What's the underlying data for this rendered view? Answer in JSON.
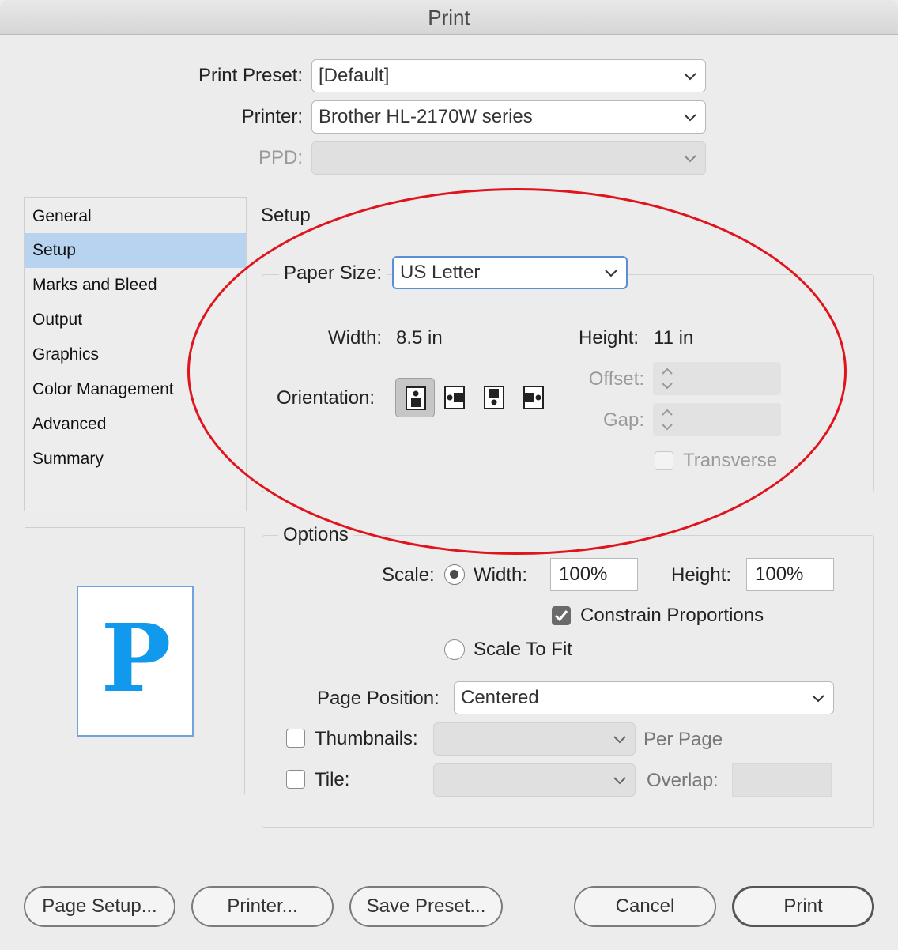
{
  "window": {
    "title": "Print"
  },
  "top": {
    "preset_label": "Print Preset:",
    "preset_value": "[Default]",
    "printer_label": "Printer:",
    "printer_value": "Brother HL-2170W series",
    "ppd_label": "PPD:",
    "ppd_value": ""
  },
  "sidebar": {
    "items": [
      {
        "label": "General",
        "selected": false
      },
      {
        "label": "Setup",
        "selected": true
      },
      {
        "label": "Marks and Bleed",
        "selected": false
      },
      {
        "label": "Output",
        "selected": false
      },
      {
        "label": "Graphics",
        "selected": false
      },
      {
        "label": "Color Management",
        "selected": false
      },
      {
        "label": "Advanced",
        "selected": false
      },
      {
        "label": "Summary",
        "selected": false
      }
    ]
  },
  "preview": {
    "letter": "P"
  },
  "setup": {
    "title": "Setup",
    "paper_size_label": "Paper Size:",
    "paper_size_value": "US Letter",
    "width_label": "Width:",
    "width_value": "8.5 in",
    "height_label": "Height:",
    "height_value": "11 in",
    "orientation_label": "Orientation:",
    "orientation_options": [
      "portrait",
      "landscape",
      "reverse-portrait",
      "reverse-landscape"
    ],
    "orientation_selected": "portrait",
    "offset_label": "Offset:",
    "gap_label": "Gap:",
    "transverse_label": "Transverse",
    "transverse_checked": false
  },
  "options": {
    "title": "Options",
    "scale_label": "Scale:",
    "width_label": "Width:",
    "width_value": "100%",
    "height_label": "Height:",
    "height_value": "100%",
    "constrain_label": "Constrain Proportions",
    "constrain_checked": true,
    "scale_to_fit_label": "Scale To Fit",
    "scale_mode": "width",
    "page_position_label": "Page Position:",
    "page_position_value": "Centered",
    "thumbnails_label": "Thumbnails:",
    "per_page_label": "Per Page",
    "tile_label": "Tile:",
    "overlap_label": "Overlap:"
  },
  "buttons": {
    "page_setup": "Page Setup...",
    "printer": "Printer...",
    "save_preset": "Save Preset...",
    "cancel": "Cancel",
    "print": "Print"
  },
  "colors": {
    "annotation_ellipse": "#e0141c",
    "selection": "#b8d3ef",
    "focus": "#5a8fd8",
    "preview_letter": "#1199ee"
  }
}
